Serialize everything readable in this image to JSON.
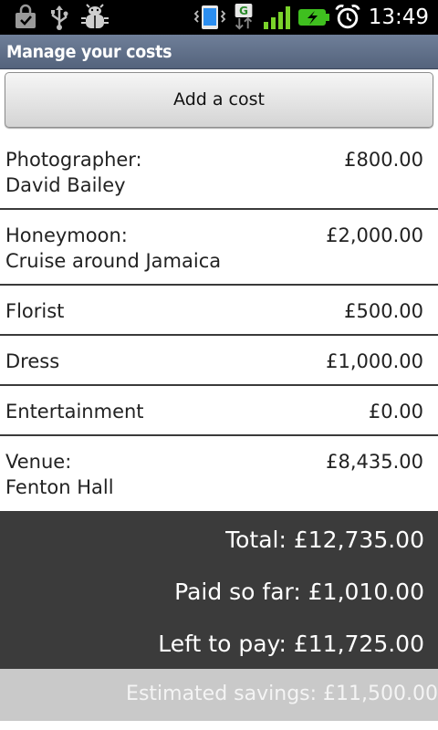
{
  "status_bar": {
    "time": "13:49",
    "icons": [
      "shopping-bag-icon",
      "usb-icon",
      "debug-bug-icon",
      "vibrate-phone-icon",
      "gprs-data-icon",
      "signal-bars-icon",
      "battery-charging-icon",
      "alarm-clock-icon"
    ],
    "network_type": "G"
  },
  "title_bar": {
    "title": "Manage your costs"
  },
  "actions": {
    "add_cost_label": "Add a cost"
  },
  "costs": [
    {
      "name": "Photographer:",
      "detail": "David Bailey",
      "amount": "£800.00"
    },
    {
      "name": "Honeymoon:",
      "detail": "Cruise around Jamaica",
      "amount": "£2,000.00"
    },
    {
      "name": "Florist",
      "detail": "",
      "amount": "£500.00"
    },
    {
      "name": "Dress",
      "detail": "",
      "amount": "£1,000.00"
    },
    {
      "name": "Entertainment",
      "detail": "",
      "amount": "£0.00"
    },
    {
      "name": "Venue:",
      "detail": "Fenton Hall",
      "amount": "£8,435.00"
    }
  ],
  "summary": {
    "total": "Total: £12,735.00",
    "paid_so_far": "Paid so far: £1,010.00",
    "left_to_pay": "Left to pay: £11,725.00",
    "estimated_savings": "Estimated savings: £11,500.00"
  },
  "colors": {
    "title_bar": "#5f6e87",
    "summary_background": "#3b3b3b",
    "savings_background": "#c9c9c9",
    "battery_green": "#3fbf1f",
    "signal_green": "#7ad32a"
  }
}
